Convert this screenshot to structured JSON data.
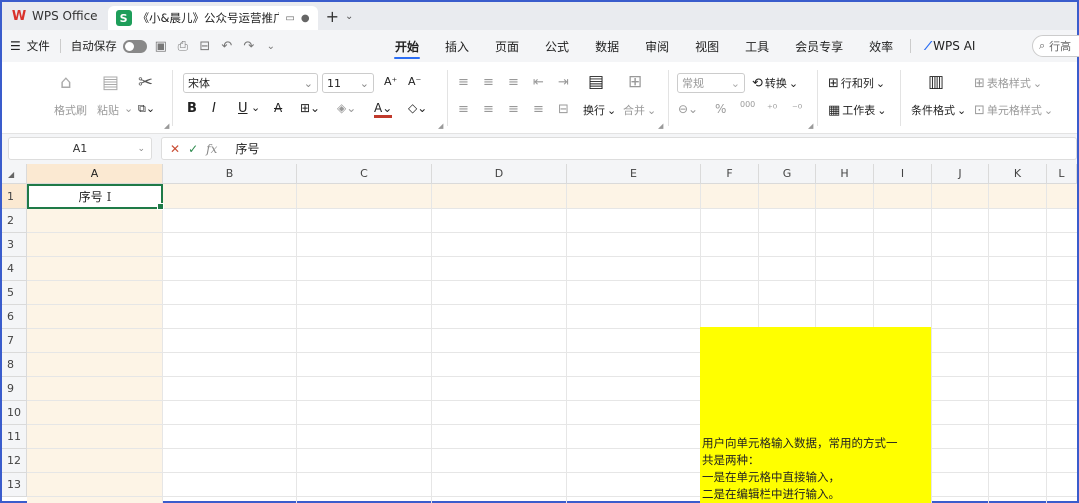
{
  "tabs": {
    "app_label": "WPS Office",
    "doc_title": "《小&晨儿》公众号运营推广"
  },
  "menu": {
    "file_label": "文件",
    "autosave_label": "自动保存",
    "tabs": [
      "开始",
      "插入",
      "页面",
      "公式",
      "数据",
      "审阅",
      "视图",
      "工具",
      "会员专享",
      "效率"
    ],
    "active_tab": "开始",
    "wps_ai_label": "WPS AI",
    "search_placeholder": "行高"
  },
  "ribbon": {
    "format_painter": "格式刷",
    "paste": "粘贴",
    "font_name": "宋体",
    "font_size": "11",
    "number_format": "常规",
    "convert": "转换",
    "row_col": "行和列",
    "worksheet": "工作表",
    "conditional_format": "条件格式",
    "table_style": "表格样式",
    "cell_style": "单元格样式",
    "wrap": "换行",
    "merge": "合并",
    "bold": "B",
    "italic": "I",
    "underline": "U",
    "percent": "%",
    "thousands": "000"
  },
  "formula": {
    "name_box": "A1",
    "fx_label": "fx",
    "value": "序号"
  },
  "grid": {
    "columns": [
      "A",
      "B",
      "C",
      "D",
      "E",
      "F",
      "G",
      "H",
      "I",
      "J",
      "K",
      "L"
    ],
    "rows": [
      "1",
      "2",
      "3",
      "4",
      "5",
      "6",
      "7",
      "8",
      "9",
      "10",
      "11",
      "12",
      "13"
    ],
    "active_cell_text": "序号"
  },
  "note": {
    "lines": [
      "用户向单元格输入数据，常用的方式一",
      "共是两种：",
      "一是在单元格中直接输入，",
      "二是在编辑栏中进行输入。"
    ]
  },
  "colors": {
    "accent": "#2a6df4",
    "selection_green": "#1f7a47",
    "note_yellow": "#ffff00",
    "header_highlight": "#fbe9d2"
  }
}
